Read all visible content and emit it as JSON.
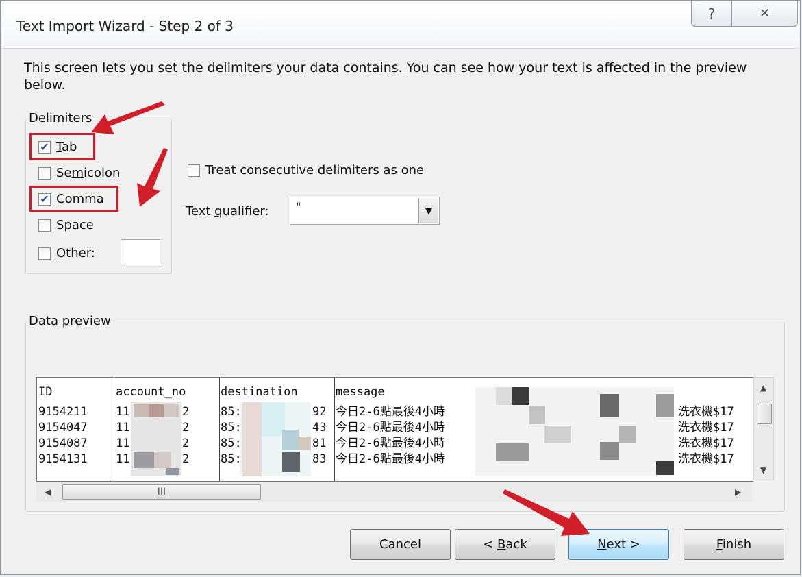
{
  "window": {
    "title": "Text Import Wizard - Step 2 of 3",
    "help_glyph": "?",
    "close_glyph": "✕"
  },
  "description": "This screen lets you set the delimiters your data contains.  You can see how your text is affected in the preview below.",
  "delimiters": {
    "legend": "Delimiters",
    "items": [
      {
        "label": "Tab",
        "mnemonic": "T",
        "checked": true
      },
      {
        "label": "Semicolon",
        "mnemonic": "m",
        "checked": false
      },
      {
        "label": "Comma",
        "mnemonic": "C",
        "checked": true
      },
      {
        "label": "Space",
        "mnemonic": "S",
        "checked": false
      },
      {
        "label": "Other:",
        "mnemonic": "O",
        "checked": false
      }
    ],
    "other_value": ""
  },
  "consecutive": {
    "label": "Treat consecutive delimiters as one",
    "mnemonic": "r",
    "checked": false
  },
  "qualifier": {
    "label": "Text qualifier:",
    "mnemonic": "q",
    "value": "\""
  },
  "preview": {
    "legend": "Data preview",
    "mnemonic": "p",
    "headers": [
      "ID",
      "account_no",
      "destination",
      "message"
    ],
    "rows": [
      {
        "id": "9154211",
        "acct_head": "11",
        "acct_tail": "2",
        "dest_head": "85:",
        "dest_tail": "92",
        "msg": "今日2-6點最後4小時",
        "msg_tail": "洗衣機$17"
      },
      {
        "id": "9154047",
        "acct_head": "11",
        "acct_tail": "2",
        "dest_head": "85:",
        "dest_tail": "43",
        "msg": "今日2-6點最後4小時",
        "msg_tail": "洗衣機$17"
      },
      {
        "id": "9154087",
        "acct_head": "11",
        "acct_tail": "2",
        "dest_head": "85:",
        "dest_tail": "81",
        "msg": "今日2-6點最後4小時",
        "msg_tail": "洗衣機$17"
      },
      {
        "id": "9154131",
        "acct_head": "11",
        "acct_tail": "2",
        "dest_head": "85:",
        "dest_tail": "83",
        "msg": "今日2-6點最後4小時",
        "msg_tail": "洗衣機$17"
      }
    ],
    "hscroll_thumb_glyph": "III"
  },
  "buttons": {
    "cancel": "Cancel",
    "back": "< Back",
    "next": "Next >",
    "finish": "Finish"
  },
  "colors": {
    "annotation": "#d11f2a",
    "default_button": "#3c7fb1"
  }
}
